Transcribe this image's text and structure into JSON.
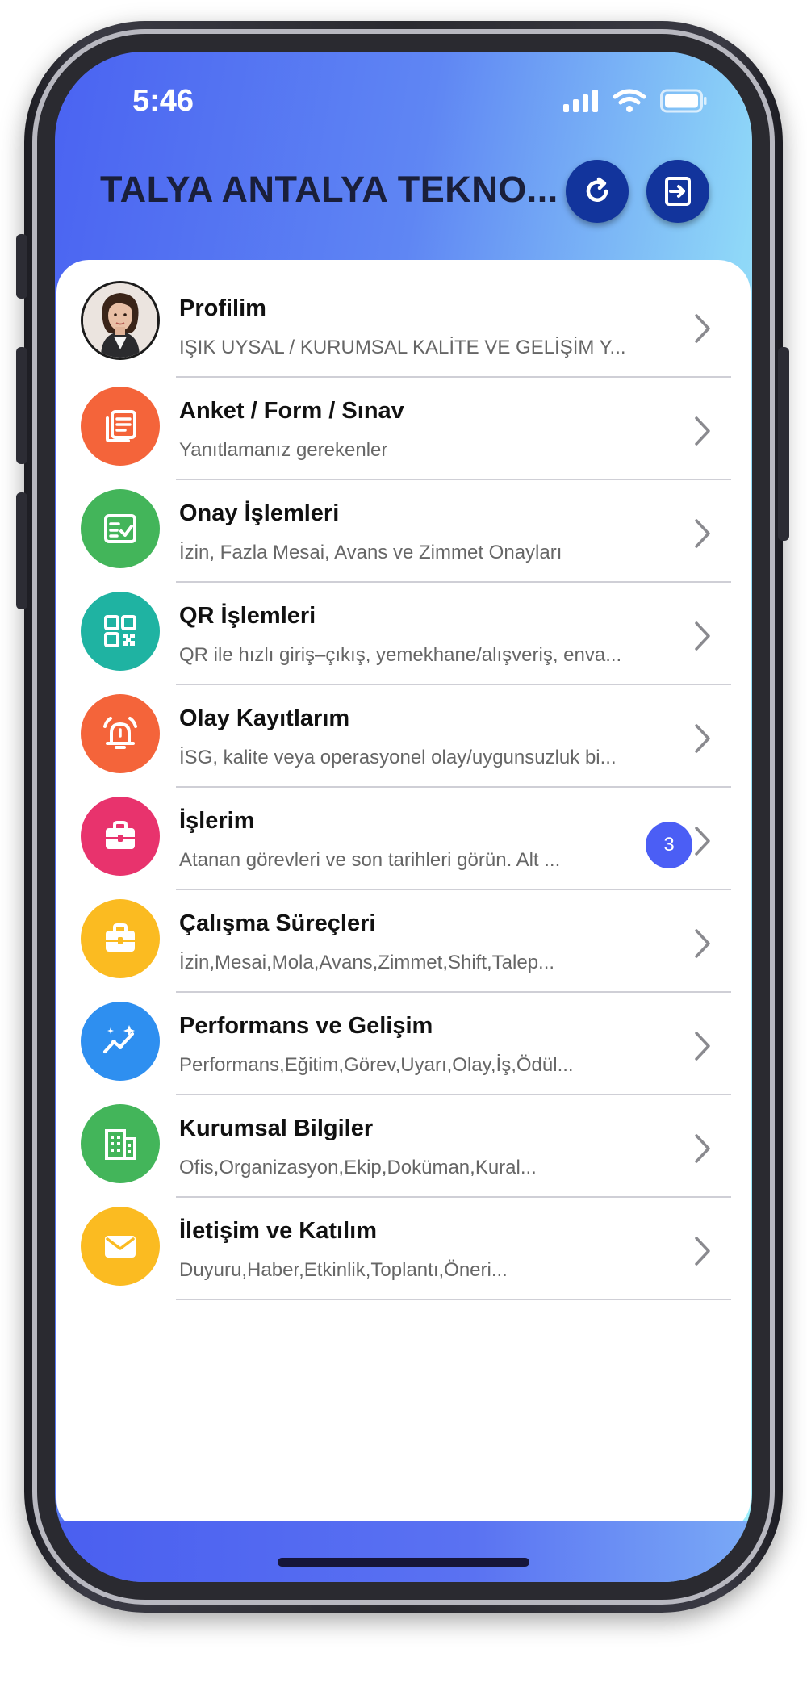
{
  "status": {
    "time": "5:46"
  },
  "header": {
    "title": "TALYA ANTALYA TEKNO..."
  },
  "items": [
    {
      "title": "Profilim",
      "subtitle": "IŞIK UYSAL / KURUMSAL KALİTE VE GELİŞİM Y...",
      "icon": "avatar",
      "color": "#f2ece8"
    },
    {
      "title": "Anket / Form / Sınav",
      "subtitle": "Yanıtlamanız gerekenler",
      "icon": "documents-icon",
      "color": "#f4643a"
    },
    {
      "title": "Onay İşlemleri",
      "subtitle": "İzin, Fazla Mesai, Avans ve Zimmet Onayları",
      "icon": "checklist-icon",
      "color": "#43b55a"
    },
    {
      "title": "QR İşlemleri",
      "subtitle": "QR ile hızlı giriş–çıkış, yemekhane/alışveriş, enva...",
      "icon": "qr-code-icon",
      "color": "#1fb3a2"
    },
    {
      "title": "Olay Kayıtlarım",
      "subtitle": "İSG, kalite veya operasyonel olay/uygunsuzluk bi...",
      "icon": "alarm-icon",
      "color": "#f4643a"
    },
    {
      "title": "İşlerim",
      "subtitle": "Atanan görevleri ve son tarihleri görün. Alt ...",
      "icon": "briefcase-icon",
      "color": "#e8336d",
      "badge": "3"
    },
    {
      "title": "Çalışma Süreçleri",
      "subtitle": "İzin,Mesai,Mola,Avans,Zimmet,Shift,Talep...",
      "icon": "briefcase-icon",
      "color": "#fbbb21"
    },
    {
      "title": "Performans ve Gelişim",
      "subtitle": "Performans,Eğitim,Görev,Uyarı,Olay,İş,Ödül...",
      "icon": "trending-icon",
      "color": "#2e8ff0"
    },
    {
      "title": "Kurumsal Bilgiler",
      "subtitle": "Ofis,Organizasyon,Ekip,Doküman,Kural...",
      "icon": "building-icon",
      "color": "#43b55a"
    },
    {
      "title": "İletişim ve Katılım",
      "subtitle": "Duyuru,Haber,Etkinlik,Toplantı,Öneri...",
      "icon": "mail-icon",
      "color": "#fbbb21"
    }
  ]
}
